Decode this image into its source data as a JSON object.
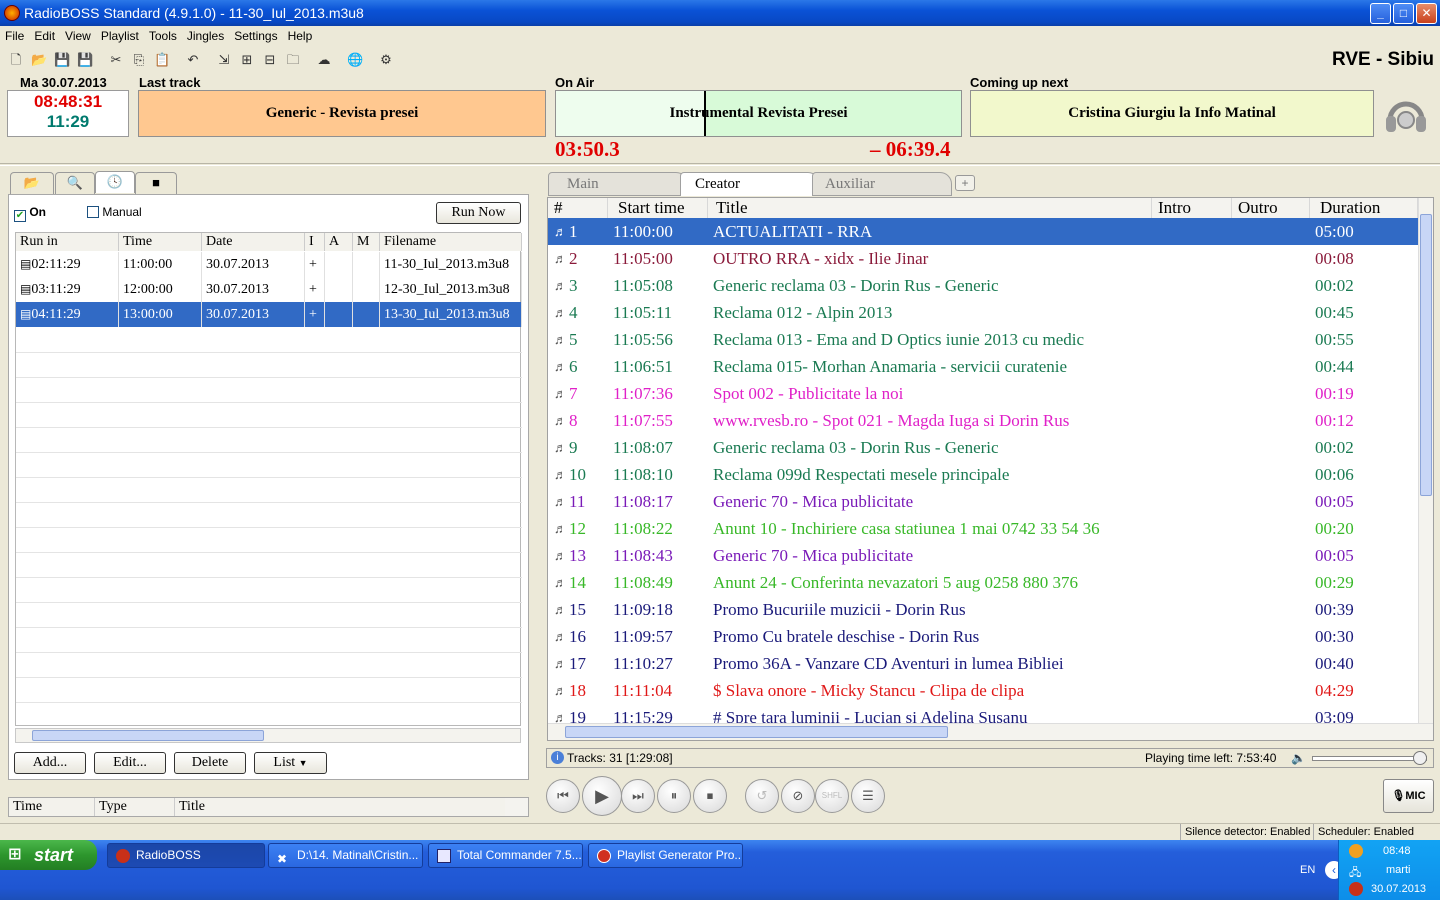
{
  "window": {
    "title": "RadioBOSS Standard (4.9.1.0) - 11-30_Iul_2013.m3u8",
    "min": "_",
    "max": "□",
    "close": "✕"
  },
  "menu": [
    "File",
    "Edit",
    "View",
    "Playlist",
    "Tools",
    "Jingles",
    "Settings",
    "Help"
  ],
  "station": "RVE - Sibiu",
  "header": {
    "date": "Ma 30.07.2013",
    "clock_time": "08:48:31",
    "clock_hour": "11:29",
    "last_label": "Last track",
    "last_track": "Generic - Revista presei",
    "onair_label": "On Air",
    "onair_track": "Instrumental Revista Presei",
    "onair_elapsed": "03:50.3",
    "onair_remaining": "– 06:39.4",
    "onair_progress": 0.37,
    "next_label": "Coming up next",
    "next_track": "Cristina Giurgiu la Info Matinal"
  },
  "scheduler": {
    "on_label": "On",
    "manual_label": "Manual",
    "run_now": "Run Now",
    "columns": [
      "Run in",
      "Time",
      "Date",
      "I",
      "A",
      "M",
      "Filename"
    ],
    "rows": [
      {
        "run_in": "02:11:29",
        "time": "11:00:00",
        "date": "30.07.2013",
        "i": "+",
        "a": "",
        "m": "",
        "file": "11-30_Iul_2013.m3u8"
      },
      {
        "run_in": "03:11:29",
        "time": "12:00:00",
        "date": "30.07.2013",
        "i": "+",
        "a": "",
        "m": "",
        "file": "12-30_Iul_2013.m3u8"
      },
      {
        "run_in": "04:11:29",
        "time": "13:00:00",
        "date": "30.07.2013",
        "i": "+",
        "a": "",
        "m": "",
        "file": "13-30_Iul_2013.m3u8"
      }
    ],
    "buttons": {
      "add": "Add...",
      "edit": "Edit...",
      "delete": "Delete",
      "list": "List"
    }
  },
  "history": {
    "columns": [
      "Time",
      "Type",
      "Title"
    ]
  },
  "playlist": {
    "tabs": [
      "Main",
      "Creator",
      "Auxiliar"
    ],
    "columns": [
      "#",
      "Start time",
      "Title",
      "Intro",
      "Outro",
      "Duration"
    ],
    "rows": [
      {
        "n": "1",
        "start": "11:00:00",
        "title": "ACTUALITATI - RRA",
        "dur": "05:00",
        "color": "#ffffff"
      },
      {
        "n": "2",
        "start": "11:05:00",
        "title": "OUTRO RRA - xidx - Ilie Jinar",
        "dur": "00:08",
        "color": "#8a1a3a"
      },
      {
        "n": "3",
        "start": "11:05:08",
        "title": "Generic reclama 03 - Dorin Rus - Generic",
        "dur": "00:02",
        "color": "#1a7a52"
      },
      {
        "n": "4",
        "start": "11:05:11",
        "title": "Reclama 012 - Alpin 2013",
        "dur": "00:45",
        "color": "#1a7a52"
      },
      {
        "n": "5",
        "start": "11:05:56",
        "title": "Reclama 013 - Ema and D Optics iunie 2013 cu medic",
        "dur": "00:55",
        "color": "#1a7a52"
      },
      {
        "n": "6",
        "start": "11:06:51",
        "title": "Reclama 015-  Morhan Anamaria - servicii curatenie",
        "dur": "00:44",
        "color": "#1a7a52"
      },
      {
        "n": "7",
        "start": "11:07:36",
        "title": "Spot 002 - Publicitate la noi",
        "dur": "00:19",
        "color": "#e020c8"
      },
      {
        "n": "8",
        "start": "11:07:55",
        "title": "www.rvesb.ro - Spot 021 - Magda Iuga si Dorin Rus",
        "dur": "00:12",
        "color": "#e020c8"
      },
      {
        "n": "9",
        "start": "11:08:07",
        "title": "Generic reclama 03 - Dorin Rus - Generic",
        "dur": "00:02",
        "color": "#1a7a52"
      },
      {
        "n": "10",
        "start": "11:08:10",
        "title": "Reclama 099d Respectati mesele  principale",
        "dur": "00:06",
        "color": "#1a7a52"
      },
      {
        "n": "11",
        "start": "11:08:17",
        "title": "Generic 70 - Mica publicitate",
        "dur": "00:05",
        "color": "#7a1ab8"
      },
      {
        "n": "12",
        "start": "11:08:22",
        "title": "Anunt 10 - Inchiriere casa statiunea 1 mai 0742 33 54 36",
        "dur": "00:20",
        "color": "#38b828"
      },
      {
        "n": "13",
        "start": "11:08:43",
        "title": "Generic 70 - Mica publicitate",
        "dur": "00:05",
        "color": "#7a1ab8"
      },
      {
        "n": "14",
        "start": "11:08:49",
        "title": "Anunt 24 - Conferinta nevazatori 5 aug 0258 880 376",
        "dur": "00:29",
        "color": "#38b828"
      },
      {
        "n": "15",
        "start": "11:09:18",
        "title": "Promo Bucuriile muzicii - Dorin Rus",
        "dur": "00:39",
        "color": "#1a1a7a"
      },
      {
        "n": "16",
        "start": "11:09:57",
        "title": "Promo Cu bratele deschise - Dorin Rus",
        "dur": "00:30",
        "color": "#1a1a7a"
      },
      {
        "n": "17",
        "start": "11:10:27",
        "title": "Promo 36A - Vanzare CD Aventuri in lumea Bibliei",
        "dur": "00:40",
        "color": "#1a1a7a"
      },
      {
        "n": "18",
        "start": "11:11:04",
        "title": "$ Slava onore - Micky Stancu - Clipa de clipa",
        "dur": "04:29",
        "color": "#e01818"
      },
      {
        "n": "19",
        "start": "11:15:29",
        "title": "# Spre tara luminii - Lucian si Adelina Susanu",
        "dur": "03:09",
        "color": "#1a1a7a"
      }
    ],
    "tracks_info": "Tracks: 31 [1:29:08]",
    "time_left": "Playing time left: 7:53:40",
    "mic": "MIC"
  },
  "transport": [
    "⏮",
    "▶",
    "⏭",
    "⏸",
    "⏹"
  ],
  "extra_buttons": [
    "↺",
    "⊘",
    "SHFL",
    "☰"
  ],
  "statusline": {
    "silence": "Silence detector: Enabled",
    "scheduler": "Scheduler: Enabled"
  },
  "taskbar": {
    "start": "start",
    "tasks": [
      "RadioBOSS",
      "D:\\14. Matinal\\Cristin...",
      "Total Commander 7.5...",
      "Playlist Generator Pro..."
    ],
    "lang": "EN",
    "time": "08:48",
    "day": "marti",
    "date": "30.07.2013"
  }
}
